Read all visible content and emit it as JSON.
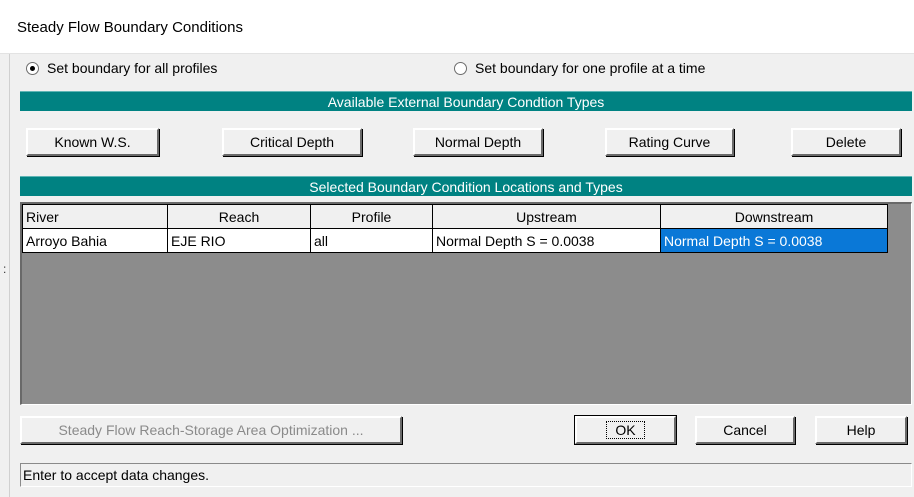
{
  "window": {
    "title": "Steady Flow Boundary Conditions"
  },
  "radios": {
    "all_profiles": {
      "label": "Set boundary for all profiles",
      "checked": true
    },
    "one_profile": {
      "label": "Set boundary for one profile at a time",
      "checked": false
    }
  },
  "types_banner": "Available External Boundary Condtion Types",
  "type_buttons": {
    "known_ws": "Known W.S.",
    "critical_depth": "Critical Depth",
    "normal_depth": "Normal Depth",
    "rating_curve": "Rating Curve",
    "delete": "Delete"
  },
  "locations_banner": "Selected Boundary Condition Locations and Types",
  "table": {
    "columns": [
      "River",
      "Reach",
      "Profile",
      "Upstream",
      "Downstream"
    ],
    "rows": [
      [
        "Arroyo Bahia",
        "EJE RIO",
        "all",
        "Normal Depth S = 0.0038",
        "Normal Depth S = 0.0038"
      ]
    ]
  },
  "bottom_buttons": {
    "optimization": "Steady Flow Reach-Storage Area Optimization ...",
    "ok": "OK",
    "cancel": "Cancel",
    "help": "Help"
  },
  "status_text": "Enter to accept data changes.",
  "stray_glyph": ":",
  "colors": {
    "banner": "#008282",
    "selection": "#0a78d7"
  }
}
